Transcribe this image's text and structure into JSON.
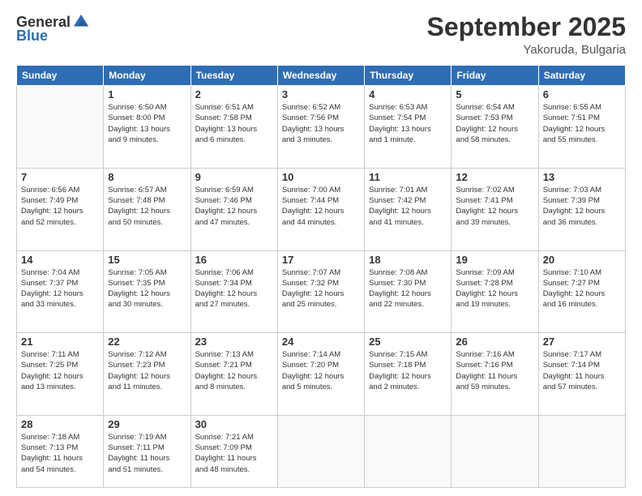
{
  "logo": {
    "general": "General",
    "blue": "Blue"
  },
  "title": {
    "month": "September 2025",
    "location": "Yakoruda, Bulgaria"
  },
  "weekdays": [
    "Sunday",
    "Monday",
    "Tuesday",
    "Wednesday",
    "Thursday",
    "Friday",
    "Saturday"
  ],
  "weeks": [
    [
      {
        "day": "",
        "info": ""
      },
      {
        "day": "1",
        "info": "Sunrise: 6:50 AM\nSunset: 8:00 PM\nDaylight: 13 hours\nand 9 minutes."
      },
      {
        "day": "2",
        "info": "Sunrise: 6:51 AM\nSunset: 7:58 PM\nDaylight: 13 hours\nand 6 minutes."
      },
      {
        "day": "3",
        "info": "Sunrise: 6:52 AM\nSunset: 7:56 PM\nDaylight: 13 hours\nand 3 minutes."
      },
      {
        "day": "4",
        "info": "Sunrise: 6:53 AM\nSunset: 7:54 PM\nDaylight: 13 hours\nand 1 minute."
      },
      {
        "day": "5",
        "info": "Sunrise: 6:54 AM\nSunset: 7:53 PM\nDaylight: 12 hours\nand 58 minutes."
      },
      {
        "day": "6",
        "info": "Sunrise: 6:55 AM\nSunset: 7:51 PM\nDaylight: 12 hours\nand 55 minutes."
      }
    ],
    [
      {
        "day": "7",
        "info": "Sunrise: 6:56 AM\nSunset: 7:49 PM\nDaylight: 12 hours\nand 52 minutes."
      },
      {
        "day": "8",
        "info": "Sunrise: 6:57 AM\nSunset: 7:48 PM\nDaylight: 12 hours\nand 50 minutes."
      },
      {
        "day": "9",
        "info": "Sunrise: 6:59 AM\nSunset: 7:46 PM\nDaylight: 12 hours\nand 47 minutes."
      },
      {
        "day": "10",
        "info": "Sunrise: 7:00 AM\nSunset: 7:44 PM\nDaylight: 12 hours\nand 44 minutes."
      },
      {
        "day": "11",
        "info": "Sunrise: 7:01 AM\nSunset: 7:42 PM\nDaylight: 12 hours\nand 41 minutes."
      },
      {
        "day": "12",
        "info": "Sunrise: 7:02 AM\nSunset: 7:41 PM\nDaylight: 12 hours\nand 39 minutes."
      },
      {
        "day": "13",
        "info": "Sunrise: 7:03 AM\nSunset: 7:39 PM\nDaylight: 12 hours\nand 36 minutes."
      }
    ],
    [
      {
        "day": "14",
        "info": "Sunrise: 7:04 AM\nSunset: 7:37 PM\nDaylight: 12 hours\nand 33 minutes."
      },
      {
        "day": "15",
        "info": "Sunrise: 7:05 AM\nSunset: 7:35 PM\nDaylight: 12 hours\nand 30 minutes."
      },
      {
        "day": "16",
        "info": "Sunrise: 7:06 AM\nSunset: 7:34 PM\nDaylight: 12 hours\nand 27 minutes."
      },
      {
        "day": "17",
        "info": "Sunrise: 7:07 AM\nSunset: 7:32 PM\nDaylight: 12 hours\nand 25 minutes."
      },
      {
        "day": "18",
        "info": "Sunrise: 7:08 AM\nSunset: 7:30 PM\nDaylight: 12 hours\nand 22 minutes."
      },
      {
        "day": "19",
        "info": "Sunrise: 7:09 AM\nSunset: 7:28 PM\nDaylight: 12 hours\nand 19 minutes."
      },
      {
        "day": "20",
        "info": "Sunrise: 7:10 AM\nSunset: 7:27 PM\nDaylight: 12 hours\nand 16 minutes."
      }
    ],
    [
      {
        "day": "21",
        "info": "Sunrise: 7:11 AM\nSunset: 7:25 PM\nDaylight: 12 hours\nand 13 minutes."
      },
      {
        "day": "22",
        "info": "Sunrise: 7:12 AM\nSunset: 7:23 PM\nDaylight: 12 hours\nand 11 minutes."
      },
      {
        "day": "23",
        "info": "Sunrise: 7:13 AM\nSunset: 7:21 PM\nDaylight: 12 hours\nand 8 minutes."
      },
      {
        "day": "24",
        "info": "Sunrise: 7:14 AM\nSunset: 7:20 PM\nDaylight: 12 hours\nand 5 minutes."
      },
      {
        "day": "25",
        "info": "Sunrise: 7:15 AM\nSunset: 7:18 PM\nDaylight: 12 hours\nand 2 minutes."
      },
      {
        "day": "26",
        "info": "Sunrise: 7:16 AM\nSunset: 7:16 PM\nDaylight: 11 hours\nand 59 minutes."
      },
      {
        "day": "27",
        "info": "Sunrise: 7:17 AM\nSunset: 7:14 PM\nDaylight: 11 hours\nand 57 minutes."
      }
    ],
    [
      {
        "day": "28",
        "info": "Sunrise: 7:18 AM\nSunset: 7:13 PM\nDaylight: 11 hours\nand 54 minutes."
      },
      {
        "day": "29",
        "info": "Sunrise: 7:19 AM\nSunset: 7:11 PM\nDaylight: 11 hours\nand 51 minutes."
      },
      {
        "day": "30",
        "info": "Sunrise: 7:21 AM\nSunset: 7:09 PM\nDaylight: 11 hours\nand 48 minutes."
      },
      {
        "day": "",
        "info": ""
      },
      {
        "day": "",
        "info": ""
      },
      {
        "day": "",
        "info": ""
      },
      {
        "day": "",
        "info": ""
      }
    ]
  ]
}
